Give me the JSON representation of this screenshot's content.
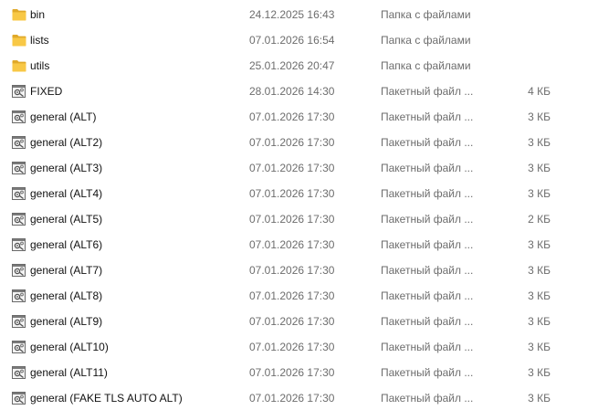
{
  "files": [
    {
      "icon": "folder-icon",
      "name": "bin",
      "date": "24.12.2025 16:43",
      "type": "Папка с файлами",
      "size": ""
    },
    {
      "icon": "folder-icon",
      "name": "lists",
      "date": "07.01.2026 16:54",
      "type": "Папка с файлами",
      "size": ""
    },
    {
      "icon": "folder-icon",
      "name": "utils",
      "date": "25.01.2026 20:47",
      "type": "Папка с файлами",
      "size": ""
    },
    {
      "icon": "batch-file-icon",
      "name": "FIXED",
      "date": "28.01.2026 14:30",
      "type": "Пакетный файл ...",
      "size": "4 КБ"
    },
    {
      "icon": "batch-file-icon",
      "name": "general (ALT)",
      "date": "07.01.2026 17:30",
      "type": "Пакетный файл ...",
      "size": "3 КБ"
    },
    {
      "icon": "batch-file-icon",
      "name": "general (ALT2)",
      "date": "07.01.2026 17:30",
      "type": "Пакетный файл ...",
      "size": "3 КБ"
    },
    {
      "icon": "batch-file-icon",
      "name": "general (ALT3)",
      "date": "07.01.2026 17:30",
      "type": "Пакетный файл ...",
      "size": "3 КБ"
    },
    {
      "icon": "batch-file-icon",
      "name": "general (ALT4)",
      "date": "07.01.2026 17:30",
      "type": "Пакетный файл ...",
      "size": "3 КБ"
    },
    {
      "icon": "batch-file-icon",
      "name": "general (ALT5)",
      "date": "07.01.2026 17:30",
      "type": "Пакетный файл ...",
      "size": "2 КБ"
    },
    {
      "icon": "batch-file-icon",
      "name": "general (ALT6)",
      "date": "07.01.2026 17:30",
      "type": "Пакетный файл ...",
      "size": "3 КБ"
    },
    {
      "icon": "batch-file-icon",
      "name": "general (ALT7)",
      "date": "07.01.2026 17:30",
      "type": "Пакетный файл ...",
      "size": "3 КБ"
    },
    {
      "icon": "batch-file-icon",
      "name": "general (ALT8)",
      "date": "07.01.2026 17:30",
      "type": "Пакетный файл ...",
      "size": "3 КБ"
    },
    {
      "icon": "batch-file-icon",
      "name": "general (ALT9)",
      "date": "07.01.2026 17:30",
      "type": "Пакетный файл ...",
      "size": "3 КБ"
    },
    {
      "icon": "batch-file-icon",
      "name": "general (ALT10)",
      "date": "07.01.2026 17:30",
      "type": "Пакетный файл ...",
      "size": "3 КБ"
    },
    {
      "icon": "batch-file-icon",
      "name": "general (ALT11)",
      "date": "07.01.2026 17:30",
      "type": "Пакетный файл ...",
      "size": "3 КБ"
    },
    {
      "icon": "batch-file-icon",
      "name": "general (FAKE TLS AUTO ALT)",
      "date": "07.01.2026 17:30",
      "type": "Пакетный файл ...",
      "size": "3 КБ"
    }
  ],
  "colors": {
    "folder": "#F8C846",
    "folder_dark": "#E0A92A",
    "text": "#111111",
    "muted": "#6D6D6D"
  }
}
